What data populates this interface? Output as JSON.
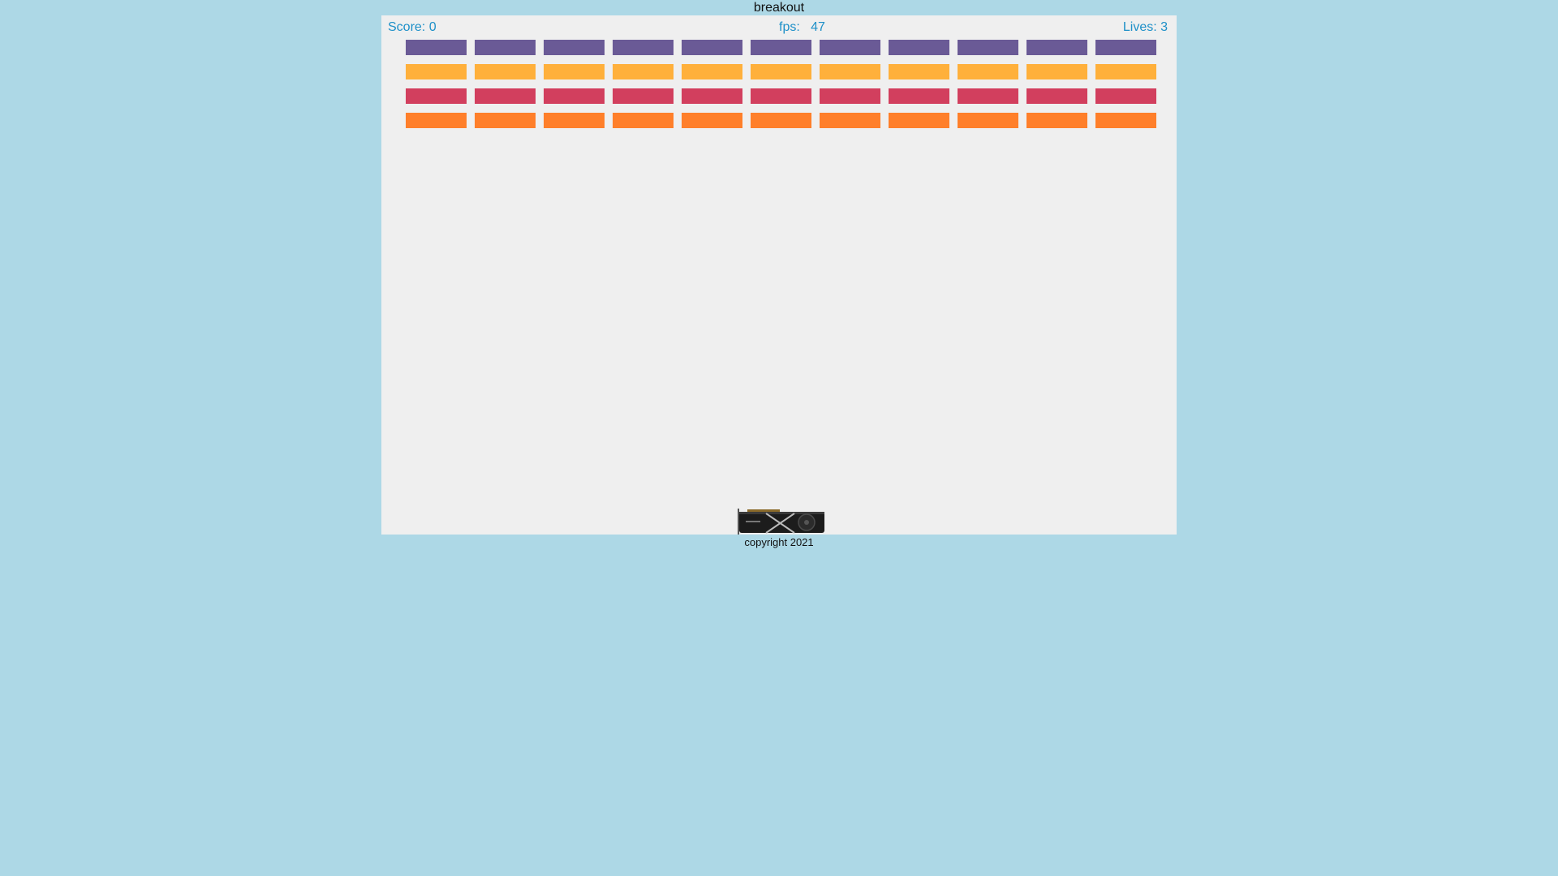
{
  "page": {
    "title": "breakout",
    "footer": "copyright 2021",
    "background_color": "#add8e6",
    "canvas_color": "#efefef"
  },
  "hud": {
    "score": "Score: 0",
    "fps": "fps:   47",
    "lives": "Lives: 3",
    "text_color": "#1e90c8"
  },
  "game": {
    "score": 0,
    "fps": 47,
    "lives": 3,
    "bricks": {
      "columns": 11,
      "rows": [
        {
          "name": "row-1",
          "color": "#6a5a96"
        },
        {
          "name": "row-2",
          "color": "#ffb03b"
        },
        {
          "name": "row-3",
          "color": "#d23f5e"
        },
        {
          "name": "row-4",
          "color": "#ff7f2a"
        }
      ]
    },
    "paddle": {
      "icon": "graphics-card-icon"
    }
  }
}
